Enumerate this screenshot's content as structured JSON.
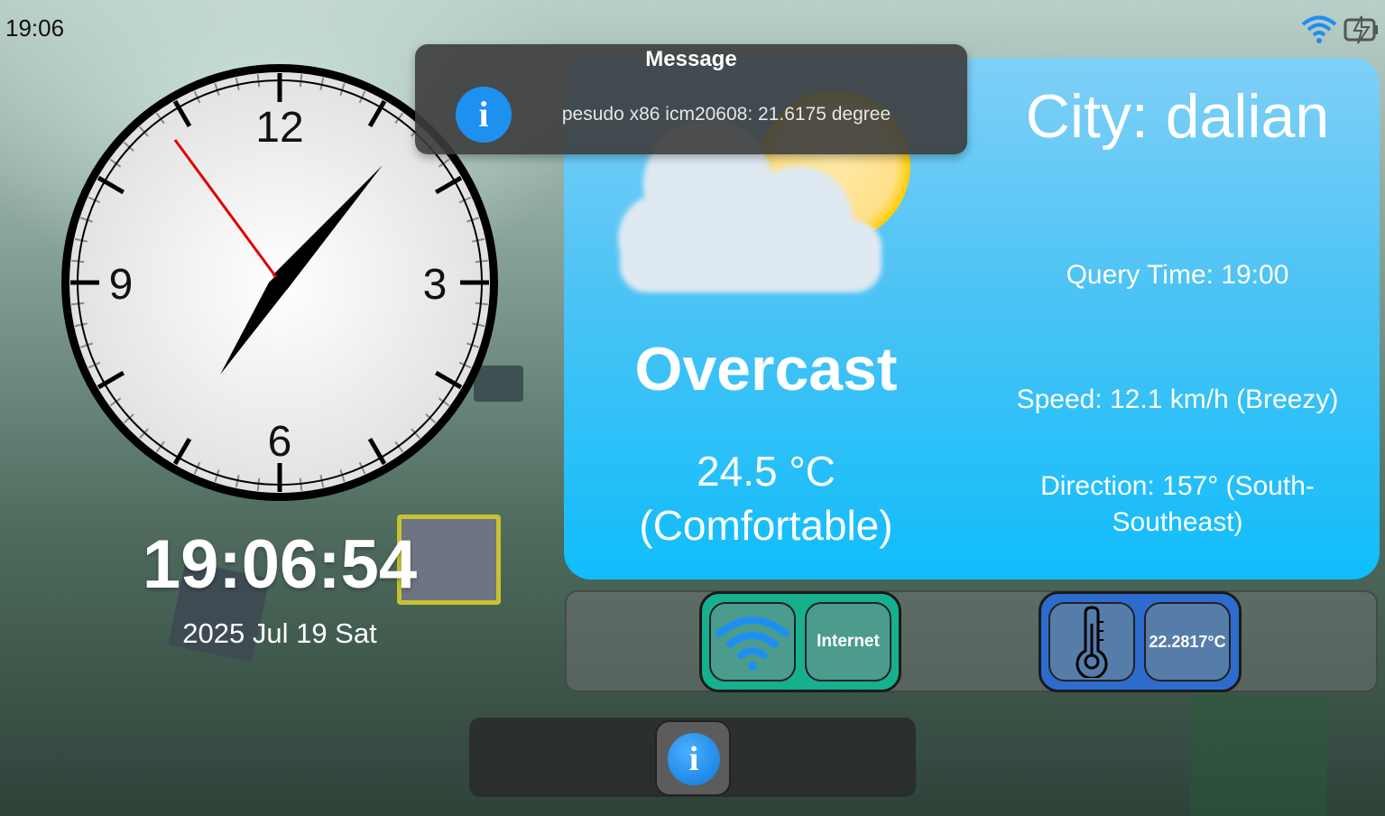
{
  "status_bar": {
    "time": "19:06",
    "icons": [
      "wifi-icon",
      "charging-battery-icon"
    ]
  },
  "clock": {
    "numerals": [
      "12",
      "3",
      "6",
      "9"
    ],
    "digital_time": "19:06:54",
    "date": "2025 Jul 19 Sat"
  },
  "weather": {
    "icon": "partly-cloudy-icon",
    "condition": "Overcast",
    "temperature": "24.5 °C",
    "comfort": "(Comfortable)",
    "city": "City: dalian",
    "query_time": "Query Time: 19:00",
    "speed": "Speed: 12.1 km/h (Breezy)",
    "direction_line1": "Direction: 157° (South-",
    "direction_line2": "Southeast)"
  },
  "message": {
    "title": "Message",
    "icon": "info-icon",
    "text": "pesudo x86 icm20608: 21.6175 degree"
  },
  "status_widgets": {
    "network_icon": "wifi-icon",
    "network_label": "Internet",
    "sensor_icon": "thermometer-icon",
    "sensor_value": "22.2817°C"
  },
  "bottom_bar": {
    "icon": "info-icon",
    "glyph": "i"
  },
  "colors": {
    "accent_blue": "#1e90f0",
    "network_green": "#16b08e",
    "sensor_blue": "#2e6bcf",
    "second_hand": "#e00000"
  }
}
